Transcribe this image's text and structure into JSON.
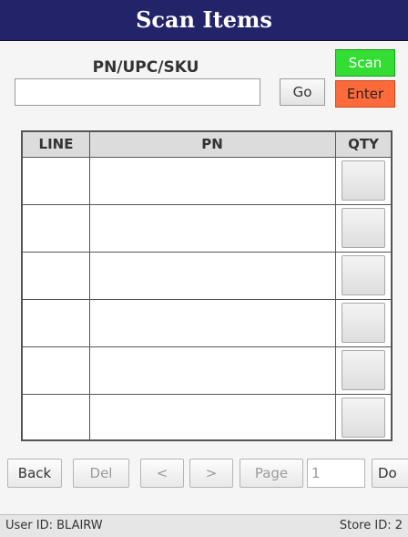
{
  "header": {
    "title": "Scan Items"
  },
  "scan_form": {
    "label": "PN/UPC/SKU",
    "input_value": "",
    "go_label": "Go",
    "scan_label": "Scan",
    "enter_label": "Enter"
  },
  "grid": {
    "columns": [
      "LINE",
      "PN",
      "QTY"
    ],
    "rows": [
      {
        "line": "",
        "pn": "",
        "qty": ""
      },
      {
        "line": "",
        "pn": "",
        "qty": ""
      },
      {
        "line": "",
        "pn": "",
        "qty": ""
      },
      {
        "line": "",
        "pn": "",
        "qty": ""
      },
      {
        "line": "",
        "pn": "",
        "qty": ""
      },
      {
        "line": "",
        "pn": "",
        "qty": ""
      }
    ]
  },
  "footer": {
    "back_label": "Back",
    "del_label": "Del",
    "prev_label": "<",
    "next_label": ">",
    "page_label": "Page",
    "page_value": "1",
    "done_label": "Do"
  },
  "status": {
    "user": "User ID: BLAIRW",
    "store": "Store ID: 2"
  },
  "colors": {
    "title_bar": "#23236a",
    "scan_button": "#33dd33",
    "enter_button": "#ff6a3a"
  }
}
